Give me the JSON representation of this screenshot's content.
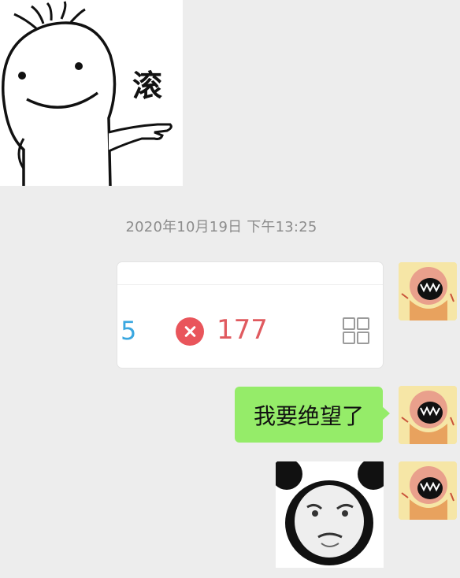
{
  "sticker": {
    "caption": "滚",
    "icon": "doodle-person-pointing"
  },
  "timestamp": "2020年10月19日 下午13:25",
  "messages": [
    {
      "type": "image",
      "sender": "self",
      "screenshot": {
        "left_number": "5",
        "count": "177",
        "status_icon": "error-x-icon",
        "menu_icon": "grid-icon"
      }
    },
    {
      "type": "text",
      "sender": "self",
      "text": "我要绝望了"
    },
    {
      "type": "image",
      "sender": "self",
      "image": "panda-face-meme"
    }
  ],
  "colors": {
    "background": "#ededed",
    "bubble_green": "#95ec69",
    "timestamp_gray": "#8c8c8c",
    "error_red": "#e9555b",
    "count_blue": "#3aa7e0"
  }
}
